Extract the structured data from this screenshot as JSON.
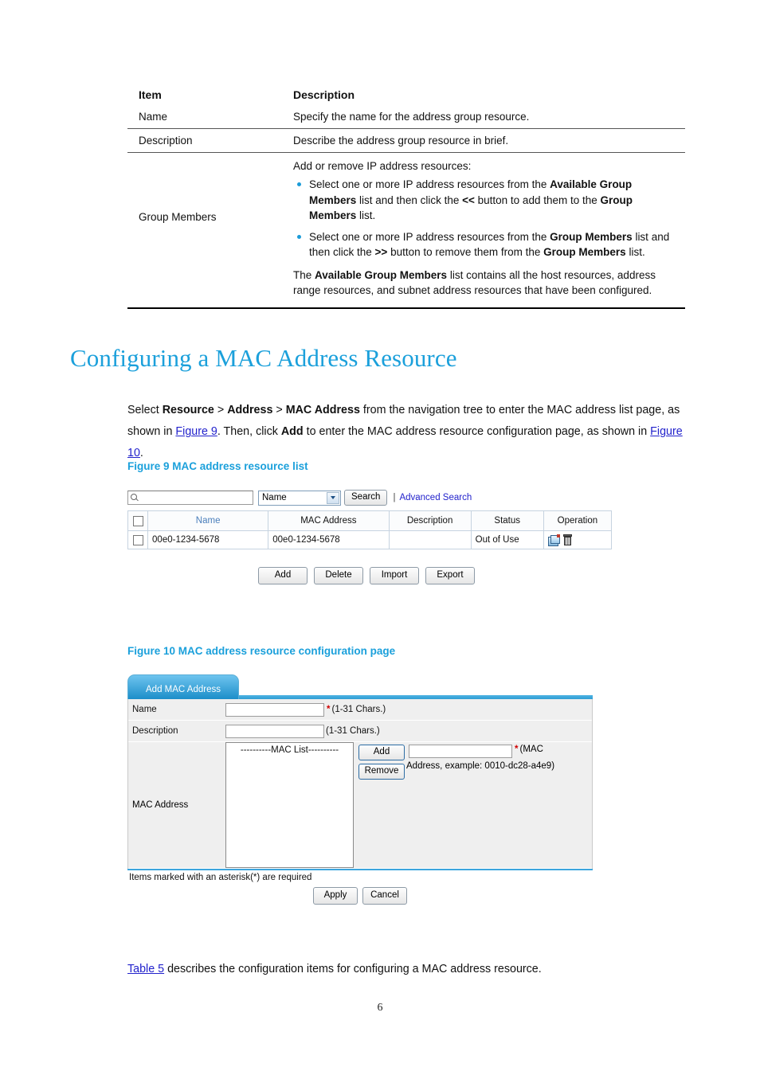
{
  "ref_table": {
    "headers": {
      "item": "Item",
      "description": "Description"
    },
    "rows": [
      {
        "item": "Name",
        "description": "Specify the name for the address group resource."
      },
      {
        "item": "Description",
        "description": "Describe the address group resource in brief."
      }
    ],
    "group_members": {
      "item": "Group Members",
      "lead": "Add or remove IP address resources:",
      "bullets": [
        {
          "p1": "Select one or more IP address resources from the ",
          "b1": "Available Group Members",
          "p2": " list and then click the ",
          "b2": "<<",
          "p3": " button to add them to the ",
          "b3": "Group Members",
          "p4": " list."
        },
        {
          "p1": "Select one or more IP address resources from the ",
          "b1": "Group Members",
          "p2": " list and then click the ",
          "b2": ">>",
          "p3": " button to remove them from the ",
          "b3": "Group Members",
          "p4": " list."
        }
      ],
      "tail": {
        "p1": "The ",
        "b1": "Available Group Members",
        "p2": " list contains all the host resources, address range resources, and subnet address resources that have been configured."
      }
    }
  },
  "heading": "Configuring a MAC Address Resource",
  "intro": {
    "p1": "Select ",
    "b1": "Resource",
    "s1": " > ",
    "b2": "Address",
    "s2": " > ",
    "b3": "MAC Address",
    "p2": " from the navigation tree to enter the MAC address list page, as shown in ",
    "link1": "Figure 9",
    "p3": ". Then, click ",
    "b4": "Add",
    "p4": " to enter the MAC address resource configuration page, as shown in ",
    "link2": "Figure 10",
    "p5": "."
  },
  "figure9": {
    "caption": "Figure 9 MAC address resource list",
    "search": {
      "icon": "search-icon",
      "input_value": "",
      "field_selected": "Name",
      "search_button": "Search",
      "separator": "|",
      "advanced_link": "Advanced Search"
    },
    "table": {
      "columns": [
        "",
        "Name",
        "MAC Address",
        "Description",
        "Status",
        "Operation"
      ],
      "rows": [
        {
          "name": "00e0-1234-5678",
          "mac": "00e0-1234-5678",
          "description": "",
          "status": "Out of Use",
          "operation_icons": [
            "edit-icon",
            "delete-icon"
          ]
        }
      ]
    },
    "buttons": [
      "Add",
      "Delete",
      "Import",
      "Export"
    ]
  },
  "figure10": {
    "caption": "Figure 10 MAC address resource configuration page",
    "tab": "Add MAC Address",
    "fields": {
      "name_label": "Name",
      "name_value": "",
      "name_required": "*",
      "name_hint": "(1-31 Chars.)",
      "description_label": "Description",
      "description_value": "",
      "description_hint": "(1-31 Chars.)",
      "mac_label": "MAC Address",
      "mac_list_placeholder": "----------MAC List----------",
      "add_button": "Add",
      "remove_button": "Remove",
      "mac_input_value": "",
      "mac_required": "*",
      "mac_note_1": "(MAC",
      "mac_note_2": "Address, example: 0010-dc28-a4e9)"
    },
    "required_note": "Items marked with an asterisk(*) are required",
    "buttons": {
      "apply": "Apply",
      "cancel": "Cancel"
    }
  },
  "outro": {
    "link": "Table 5",
    "text": " describes the configuration items for configuring a MAC address resource."
  },
  "footer": {
    "page_number": "6"
  },
  "colors": {
    "heading_blue": "#1ba0db",
    "link_blue": "#2222cc",
    "bullet_blue": "#1b9bd8",
    "required_red": "#d00000",
    "tab_blue": "#1c8ec9"
  }
}
